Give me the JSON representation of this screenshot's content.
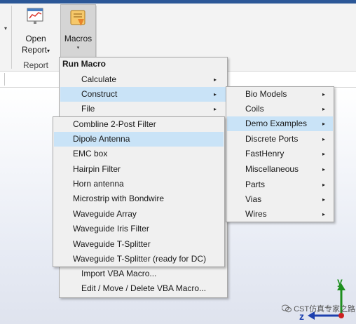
{
  "ribbon": {
    "open_report": {
      "line1": "Open",
      "line2": "Report",
      "dropdown": "▾"
    },
    "macros": {
      "label": "Macros",
      "dropdown": "▾"
    },
    "group_label": "Report",
    "left_arrow": "▾"
  },
  "run_macro_menu": {
    "title": "Run Macro",
    "items": [
      {
        "label": "Calculate",
        "submenu": "▸"
      },
      {
        "label": "Construct",
        "submenu": "▸"
      },
      {
        "label": "File",
        "submenu": "▸"
      }
    ],
    "bottom_items": [
      {
        "label": "Import VBA Macro..."
      },
      {
        "label": "Edit / Move / Delete VBA Macro..."
      }
    ]
  },
  "demo_examples_menu": {
    "items": [
      {
        "label": "Combline 2-Post Filter"
      },
      {
        "label": "Dipole Antenna"
      },
      {
        "label": "EMC box"
      },
      {
        "label": "Hairpin Filter"
      },
      {
        "label": "Horn antenna"
      },
      {
        "label": "Microstrip with Bondwire"
      },
      {
        "label": "Waveguide Array"
      },
      {
        "label": "Waveguide Iris Filter"
      },
      {
        "label": "Waveguide T-Splitter"
      },
      {
        "label": "Waveguide T-Splitter (ready for DC)"
      }
    ]
  },
  "construct_menu": {
    "items": [
      {
        "label": "Bio Models",
        "submenu": "▸"
      },
      {
        "label": "Coils",
        "submenu": "▸"
      },
      {
        "label": "Demo Examples",
        "submenu": "▸"
      },
      {
        "label": "Discrete Ports",
        "submenu": "▸"
      },
      {
        "label": "FastHenry",
        "submenu": "▸"
      },
      {
        "label": "Miscellaneous",
        "submenu": "▸"
      },
      {
        "label": "Parts",
        "submenu": "▸"
      },
      {
        "label": "Vias",
        "submenu": "▸"
      },
      {
        "label": "Wires",
        "submenu": "▸"
      }
    ]
  },
  "axis": {
    "y": "y",
    "z": "z"
  },
  "watermark": {
    "text": "CST仿真专家之路"
  },
  "colors": {
    "highlight": "#c9e3f7",
    "axis_green": "#1e8f1e",
    "axis_blue": "#1c3fae",
    "axis_dot": "#cc2222"
  },
  "icons": {
    "open_report": "report-icon",
    "macros": "macro-scroll-icon",
    "wechat": "wechat-icon"
  }
}
